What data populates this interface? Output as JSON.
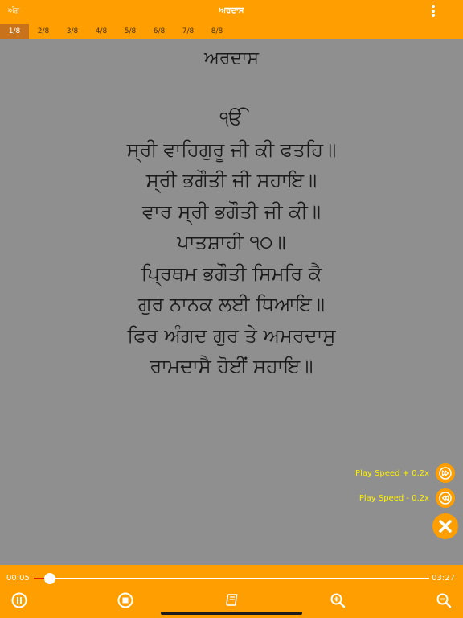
{
  "header": {
    "back_label": "ਅੰਗ",
    "title": "ਅਰਦਾਸ"
  },
  "tabs": [
    {
      "label": "1/8",
      "active": true
    },
    {
      "label": "2/8",
      "active": false
    },
    {
      "label": "3/8",
      "active": false
    },
    {
      "label": "4/8",
      "active": false
    },
    {
      "label": "5/8",
      "active": false
    },
    {
      "label": "6/8",
      "active": false
    },
    {
      "label": "7/8",
      "active": false
    },
    {
      "label": "8/8",
      "active": false
    }
  ],
  "content": {
    "heading": "ਅਰਦਾਸ",
    "verses": [
      "ੴ",
      "ਸ੍ਰੀ ਵਾਹਿਗੁਰੂ ਜੀ ਕੀ ਫਤਹਿ॥",
      "ਸ੍ਰੀ ਭਗੌਤੀ ਜੀ ਸਹਾਇ॥",
      "ਵਾਰ ਸ੍ਰੀ ਭਗੌਤੀ ਜੀ ਕੀ॥",
      "ਪਾਤਸ਼ਾਹੀ ੧੦॥",
      "ਪ੍ਰਿਥਮ ਭਗੌਤੀ ਸਿਮਰਿ ਕੈ",
      "ਗੁਰ ਨਾਨਕ ਲਈ ਧਿਆਇ॥",
      "ਫਿਰ ਅੰਗਦ ਗੁਰ ਤੇ ਅਮਰਦਾਸੁ",
      "ਰਾਮਦਾਸੈ ਹੋਈਂ ਸਹਾਇ॥"
    ]
  },
  "speed": {
    "increase_label": "Play Speed + 0.2x",
    "decrease_label": "Play Speed - 0.2x",
    "increase_icon": "fast-forward-icon",
    "decrease_icon": "rewind-icon",
    "close_icon": "close-icon"
  },
  "player": {
    "current_time": "00:05",
    "total_time": "03:27",
    "progress": 0.04,
    "controls": [
      "pause-icon",
      "stop-icon",
      "book-icon",
      "zoom-in-icon",
      "zoom-out-icon"
    ]
  },
  "colors": {
    "accent": "#ff9e00",
    "active_tab": "#c8731b",
    "background": "#8f8f8f",
    "speed_label": "#fff000",
    "seek_fill": "#e02000"
  }
}
